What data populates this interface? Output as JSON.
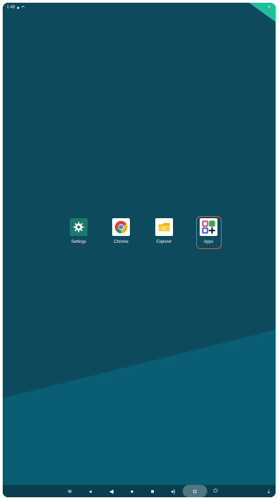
{
  "status_bar": {
    "time": "1:49",
    "right_indicator": "▾"
  },
  "desktop": {
    "icons": [
      {
        "label": "Settings",
        "icon": "gear-icon",
        "color": "#1a7a6a"
      },
      {
        "label": "Chrome",
        "icon": "chrome-icon",
        "color": "#ffffff"
      },
      {
        "label": "Explorer",
        "icon": "folder-icon",
        "color": "#ffffff"
      },
      {
        "label": "Apps",
        "icon": "apps-grid-icon",
        "color": "#ffffff"
      }
    ]
  },
  "nav_bar": {
    "buttons": [
      {
        "name": "menu-button",
        "glyph": "≋"
      },
      {
        "name": "volume-down-button",
        "glyph": "◂"
      },
      {
        "name": "back-button",
        "glyph": "◀"
      },
      {
        "name": "home-button",
        "glyph": "●"
      },
      {
        "name": "recents-button",
        "glyph": "■"
      },
      {
        "name": "volume-up-button",
        "glyph": "◂)"
      },
      {
        "name": "screenshot-button",
        "glyph": "◘"
      },
      {
        "name": "power-button",
        "glyph": "⏻"
      },
      {
        "name": "keyboard-button",
        "glyph": "⇣"
      }
    ]
  },
  "colors": {
    "wallpaper_dark": "#0d4a5e",
    "wallpaper_light": "#0a5e73",
    "accent_corner": "#1fbf9a",
    "highlight": "#e0613e"
  }
}
